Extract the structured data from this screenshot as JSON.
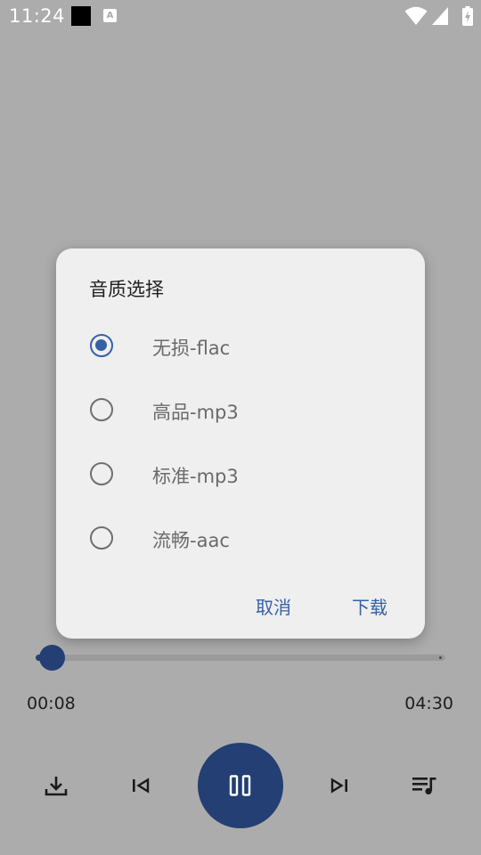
{
  "status_bar": {
    "time": "11:24",
    "notification_letter": "A"
  },
  "dialog": {
    "title": "音质选择",
    "options": [
      {
        "label": "无损-flac",
        "selected": true
      },
      {
        "label": "高品-mp3",
        "selected": false
      },
      {
        "label": "标准-mp3",
        "selected": false
      },
      {
        "label": "流畅-aac",
        "selected": false
      }
    ],
    "cancel_label": "取消",
    "download_label": "下载"
  },
  "player": {
    "current_time": "00:08",
    "total_time": "04:30",
    "progress_fraction": 0.03,
    "is_playing": true
  },
  "controls": {
    "icons": [
      "download-icon",
      "skip-previous-icon",
      "pause-icon",
      "skip-next-icon",
      "queue-music-icon"
    ]
  },
  "colors": {
    "accent": "#3561a4",
    "player_dark": "#233f74",
    "scrim": "#acacac",
    "dialog_bg": "#efefef"
  }
}
